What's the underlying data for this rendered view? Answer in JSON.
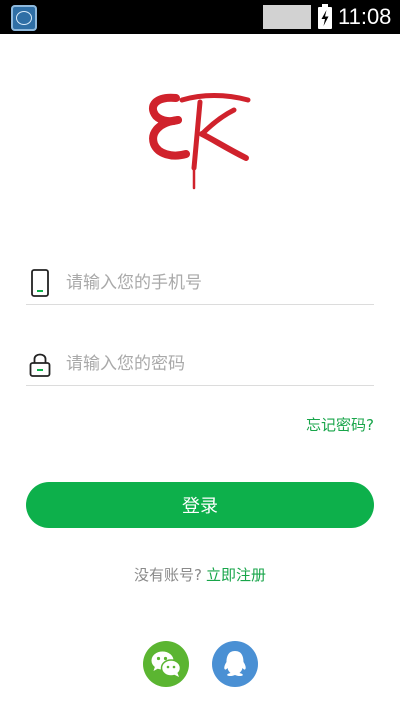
{
  "status_bar": {
    "time": "11:08",
    "icons": [
      "app-thumbnail-icon",
      "notification-placeholder",
      "battery-charging-icon"
    ]
  },
  "logo": {
    "icon": "ek-brand-logo",
    "color": "#d0222c"
  },
  "form": {
    "phone": {
      "icon": "phone-icon",
      "placeholder": "请输入您的手机号",
      "value": ""
    },
    "password": {
      "icon": "lock-icon",
      "placeholder": "请输入您的密码",
      "value": ""
    },
    "forgot_password": "忘记密码?",
    "login_label": "登录"
  },
  "register": {
    "prompt": "没有账号?",
    "link": "立即注册"
  },
  "social": [
    {
      "icon": "wechat-icon",
      "color": "#5bb531"
    },
    {
      "icon": "qq-icon",
      "color": "#4a90d4"
    }
  ],
  "colors": {
    "accent": "#0db04b",
    "link": "#18a54a"
  }
}
